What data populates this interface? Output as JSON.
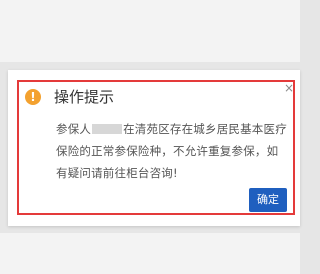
{
  "dialog": {
    "title": "操作提示",
    "icon": "warning-icon",
    "close_glyph": "×",
    "message_part1": "参保人",
    "message_part2": "在清苑区存在城乡居民基本医疗保险的正常参保险种，不允许重复参保，如有疑问请前往柜台咨询!",
    "confirm_label": "确定"
  },
  "colors": {
    "highlight_border": "#e43a3a",
    "confirm_button": "#1f5fbf",
    "warning_icon": "#f3a12f"
  }
}
